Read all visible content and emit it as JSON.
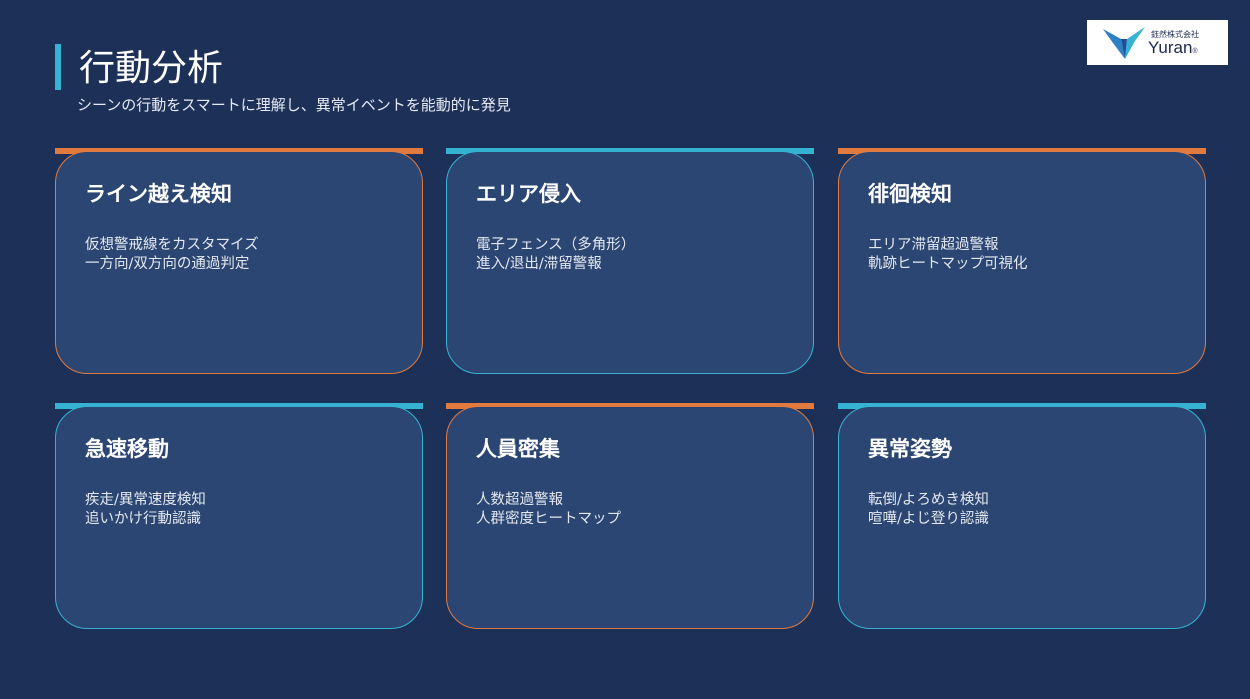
{
  "header": {
    "title": "行動分析",
    "subtitle": "シーンの行動をスマートに理解し、異常イベントを能動的に発見"
  },
  "logo": {
    "company": "鈺然株式会社",
    "brand": "Yuran",
    "mark": "®"
  },
  "colors": {
    "background": "#1d3158",
    "card": "#2b4672",
    "accent_orange": "#e07a3f",
    "accent_blue": "#36b3d3"
  },
  "cards": [
    {
      "title": "ライン越え検知",
      "accent": "orange",
      "lines": [
        "仮想警戒線をカスタマイズ",
        "一方向/双方向の通過判定"
      ]
    },
    {
      "title": "エリア侵入",
      "accent": "blue",
      "lines": [
        "電子フェンス（多角形）",
        "進入/退出/滞留警報"
      ]
    },
    {
      "title": "徘徊検知",
      "accent": "orange",
      "lines": [
        "エリア滞留超過警報",
        "軌跡ヒートマップ可視化"
      ]
    },
    {
      "title": "急速移動",
      "accent": "blue",
      "lines": [
        "疾走/異常速度検知",
        "追いかけ行動認識"
      ]
    },
    {
      "title": "人員密集",
      "accent": "orange",
      "lines": [
        "人数超過警報",
        "人群密度ヒートマップ"
      ]
    },
    {
      "title": "異常姿勢",
      "accent": "blue",
      "lines": [
        "転倒/よろめき検知",
        "喧嘩/よじ登り認識"
      ]
    }
  ]
}
